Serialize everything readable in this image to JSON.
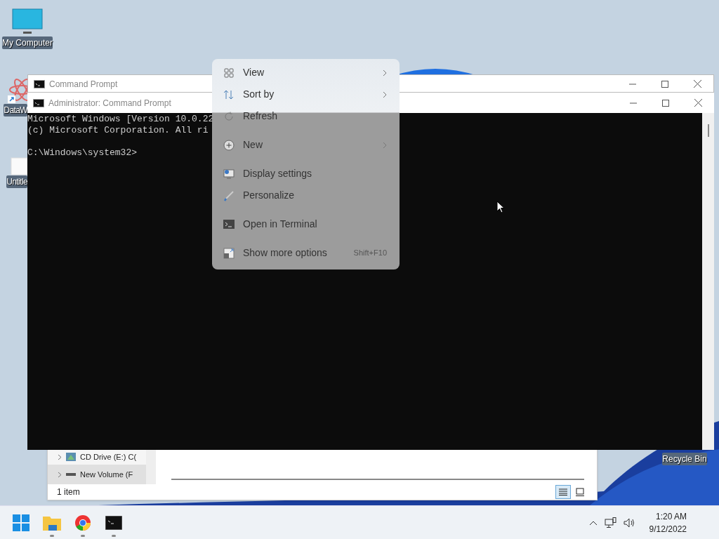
{
  "desktop_icons": [
    {
      "kind": "computer",
      "label": "My Computer"
    },
    {
      "kind": "app",
      "label": "DataW"
    },
    {
      "kind": "document",
      "label": "Untitle"
    },
    {
      "kind": "recycle",
      "label": "Recycle Bin"
    }
  ],
  "explorer": {
    "tree_items": [
      {
        "kind": "cd",
        "label": "CD Drive (E:) C(",
        "selected": false
      },
      {
        "kind": "volume",
        "label": "New Volume (F",
        "selected": true
      }
    ],
    "status": "1 item",
    "view_buttons": [
      {
        "kind": "details",
        "selected": true
      },
      {
        "kind": "tiles",
        "selected": false
      }
    ]
  },
  "cmd_back": {
    "title": "Command Prompt"
  },
  "cmd_front": {
    "title": "Administrator: Command Prompt",
    "lines": [
      "Microsoft Windows [Version 10.0.22",
      "(c) Microsoft Corporation. All ri"
    ],
    "prompt": "C:\\Windows\\system32>"
  },
  "context_menu": {
    "items": [
      {
        "kind": "view",
        "label": "View",
        "submenu": true
      },
      {
        "kind": "sort",
        "label": "Sort by",
        "submenu": true
      },
      {
        "kind": "refresh",
        "label": "Refresh",
        "submenu": false
      },
      {
        "kind": "new",
        "label": "New",
        "submenu": true
      },
      {
        "kind": "display",
        "label": "Display settings",
        "submenu": false
      },
      {
        "kind": "personalize",
        "label": "Personalize",
        "submenu": false
      },
      {
        "kind": "terminal",
        "label": "Open in Terminal",
        "submenu": false
      },
      {
        "kind": "more",
        "label": "Show more options",
        "submenu": false,
        "shortcut": "Shift+F10"
      }
    ]
  },
  "taskbar": {
    "apps": [
      {
        "kind": "start",
        "running": false
      },
      {
        "kind": "folder",
        "running": true
      },
      {
        "kind": "browser",
        "running": true
      },
      {
        "kind": "terminal",
        "running": true
      }
    ],
    "time": "1:20 AM",
    "date": "9/12/2022"
  }
}
